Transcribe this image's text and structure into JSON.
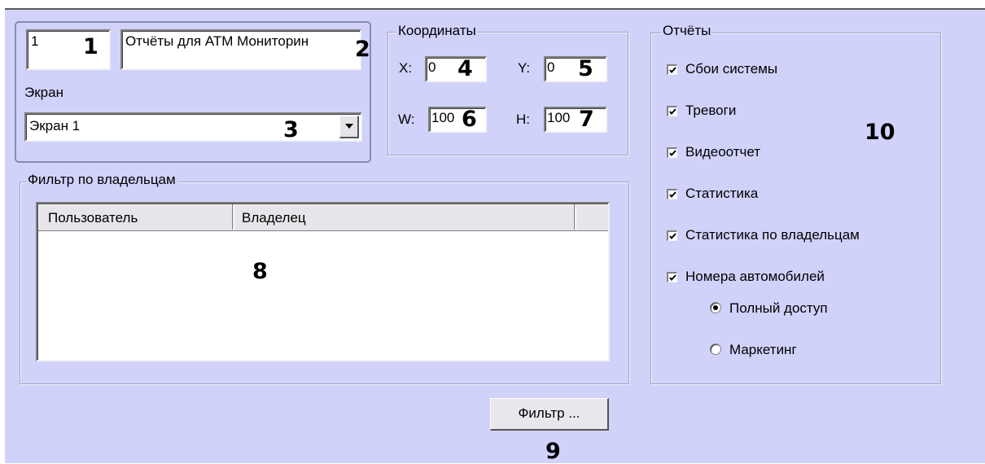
{
  "object": {
    "id_value": "1",
    "name_value": "Отчёты для АТМ Мониторин",
    "screen_label": "Экран",
    "screen_value": "Экран 1"
  },
  "coordinates": {
    "title": "Координаты",
    "x_label": "X:",
    "x_value": "0",
    "y_label": "Y:",
    "y_value": "0",
    "w_label": "W:",
    "w_value": "100",
    "h_label": "H:",
    "h_value": "100"
  },
  "reports": {
    "title": "Отчёты",
    "items": [
      {
        "label": "Сбои системы",
        "checked": true
      },
      {
        "label": "Тревоги",
        "checked": true
      },
      {
        "label": "Видеоотчет",
        "checked": true
      },
      {
        "label": "Статистика",
        "checked": true
      },
      {
        "label": "Статистика по владельцам",
        "checked": true
      },
      {
        "label": "Номера автомобилей",
        "checked": true
      }
    ],
    "radios": [
      {
        "label": "Полный доступ",
        "selected": true
      },
      {
        "label": "Маркетинг",
        "selected": false
      }
    ]
  },
  "owner_filter": {
    "title": "Фильтр по владельцам",
    "columns": [
      "Пользователь",
      "Владелец"
    ]
  },
  "filter_button": "Фильтр ...",
  "callouts": [
    "1",
    "2",
    "3",
    "4",
    "5",
    "6",
    "7",
    "8",
    "9",
    "10"
  ],
  "icons": {
    "dropdown": "dropdown-arrow-icon",
    "check": "checkmark-icon"
  }
}
